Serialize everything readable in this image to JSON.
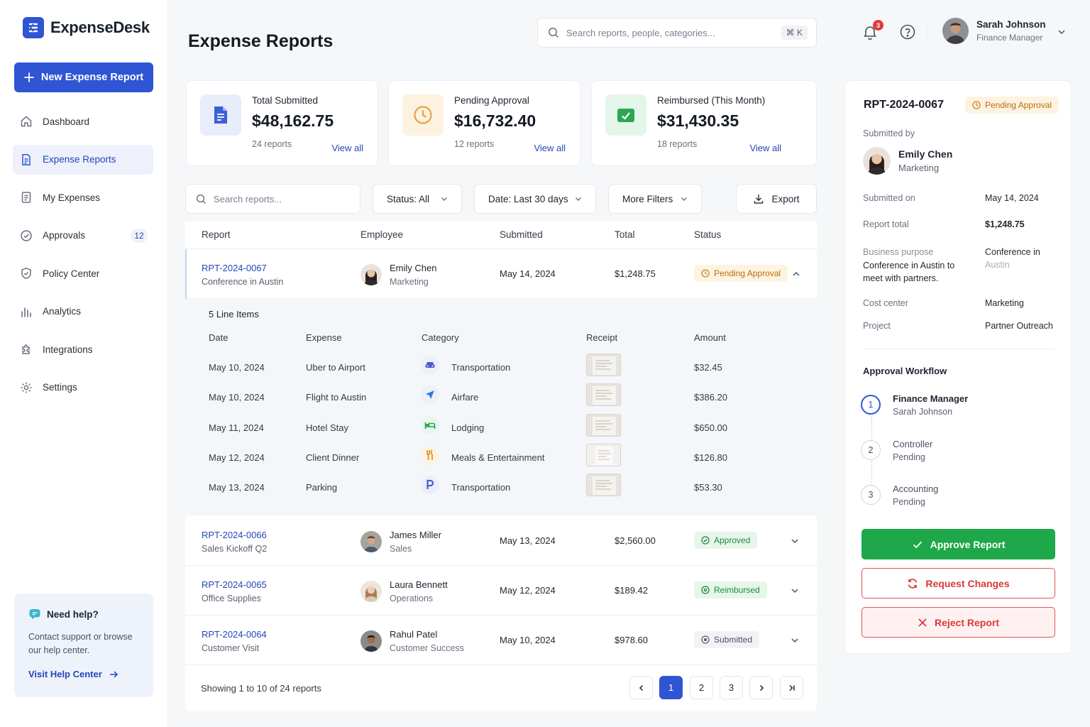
{
  "app": {
    "name": "ExpenseDesk"
  },
  "sidebar": {
    "new_button": "New Expense Report",
    "items": [
      {
        "label": "Dashboard",
        "icon": "home-icon"
      },
      {
        "label": "Expense Reports",
        "icon": "document-icon",
        "active": true
      },
      {
        "label": "My Expenses",
        "icon": "receipt-icon"
      },
      {
        "label": "Approvals",
        "icon": "check-circle-icon",
        "badge": "12"
      },
      {
        "label": "Policy Center",
        "icon": "shield-icon"
      },
      {
        "label": "Analytics",
        "icon": "bar-chart-icon"
      },
      {
        "label": "Integrations",
        "icon": "puzzle-icon"
      },
      {
        "label": "Settings",
        "icon": "gear-icon"
      }
    ],
    "help": {
      "title": "Need help?",
      "text": "Contact support or browse our help center.",
      "link": "Visit Help Center"
    }
  },
  "header": {
    "title": "Expense Reports",
    "search_placeholder": "Search reports, people, categories...",
    "shortcut": "⌘ K",
    "notifications": "3",
    "user": {
      "name": "Sarah Johnson",
      "role": "Finance Manager"
    }
  },
  "stats": [
    {
      "label": "Total Submitted",
      "value": "$48,162.75",
      "sub": "24 reports",
      "link": "View all",
      "color": "#3b5fd6"
    },
    {
      "label": "Pending Approval",
      "value": "$16,732.40",
      "sub": "12 reports",
      "link": "View all",
      "color": "#e8a23a"
    },
    {
      "label": "Reimbursed (This Month)",
      "value": "$31,430.35",
      "sub": "18 reports",
      "link": "View all",
      "color": "#2aa756"
    }
  ],
  "toolbar": {
    "search_placeholder": "Search reports...",
    "status_filter": "Status: All",
    "date_filter": "Date: Last 30 days",
    "more_filters": "More Filters",
    "export": "Export"
  },
  "table": {
    "headers": [
      "Report",
      "Employee",
      "Submitted",
      "Total",
      "Status"
    ],
    "rows": [
      {
        "id": "RPT-2024-0067",
        "title": "Conference in Austin",
        "employee": "Emily Chen",
        "dept": "Marketing",
        "submitted": "May 14, 2024",
        "total": "$1,248.75",
        "status": "Pending Approval"
      },
      {
        "id": "RPT-2024-0066",
        "title": "Sales Kickoff Q2",
        "employee": "James Miller",
        "dept": "Sales",
        "submitted": "May 13, 2024",
        "total": "$2,560.00",
        "status": "Approved"
      },
      {
        "id": "RPT-2024-0065",
        "title": "Office Supplies",
        "employee": "Laura Bennett",
        "dept": "Operations",
        "submitted": "May 12, 2024",
        "total": "$189.42",
        "status": "Reimbursed"
      },
      {
        "id": "RPT-2024-0064",
        "title": "Customer Visit",
        "employee": "Rahul Patel",
        "dept": "Customer Success",
        "submitted": "May 10, 2024",
        "total": "$978.60",
        "status": "Submitted"
      }
    ],
    "line_items": {
      "title": "5 Line Items",
      "headers": [
        "Date",
        "Expense",
        "Category",
        "Receipt",
        "Amount"
      ],
      "items": [
        {
          "date": "May 10, 2024",
          "expense": "Uber to Airport",
          "category": "Transportation",
          "icon": "car-icon",
          "amount": "$32.45"
        },
        {
          "date": "May 10, 2024",
          "expense": "Flight to Austin",
          "category": "Airfare",
          "icon": "plane-icon",
          "amount": "$386.20"
        },
        {
          "date": "May 11, 2024",
          "expense": "Hotel Stay",
          "category": "Lodging",
          "icon": "bed-icon",
          "amount": "$650.00"
        },
        {
          "date": "May 12, 2024",
          "expense": "Client Dinner",
          "category": "Meals & Entertainment",
          "icon": "utensils-icon",
          "amount": "$126.80"
        },
        {
          "date": "May 13, 2024",
          "expense": "Parking",
          "category": "Transportation",
          "icon": "parking-icon",
          "amount": "$53.30"
        }
      ]
    },
    "pagination": {
      "summary": "Showing 1 to 10 of 24 reports",
      "pages": [
        "1",
        "2",
        "3"
      ],
      "current": "1"
    }
  },
  "panel": {
    "id": "RPT-2024-0067",
    "status": "Pending Approval",
    "submitted_by_label": "Submitted by",
    "submitter": {
      "name": "Emily Chen",
      "dept": "Marketing"
    },
    "fields": {
      "submitted_on_label": "Submitted on",
      "submitted_on": "May 14, 2024",
      "total_label": "Report total",
      "total": "$1,248.75",
      "purpose_label": "Business purpose",
      "purpose_text": "Conference in Austin to meet with partners.",
      "purpose_value": "Conference in",
      "purpose_value2": "Austin",
      "cost_center_label": "Cost center",
      "cost_center": "Marketing",
      "project_label": "Project",
      "project": "Partner Outreach"
    },
    "workflow": {
      "title": "Approval Workflow",
      "steps": [
        {
          "num": "1",
          "name": "Finance Manager",
          "status": "Sarah Johnson"
        },
        {
          "num": "2",
          "name": "Controller",
          "status": "Pending"
        },
        {
          "num": "3",
          "name": "Accounting",
          "status": "Pending"
        }
      ]
    },
    "actions": {
      "approve": "Approve Report",
      "changes": "Request Changes",
      "reject": "Reject Report"
    }
  }
}
